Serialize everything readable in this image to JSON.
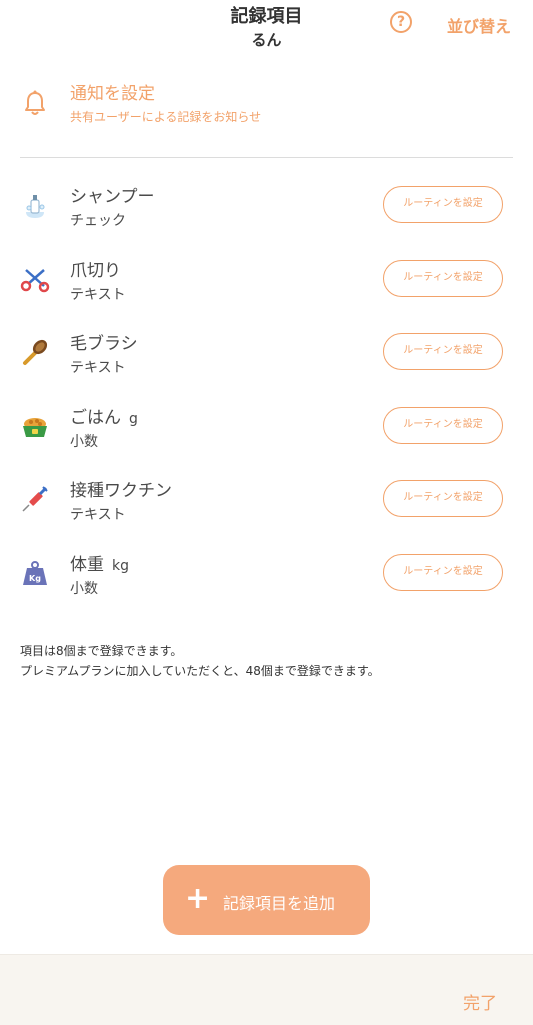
{
  "header": {
    "title": "記録項目",
    "subtitle": "るん",
    "help_icon": "?",
    "sort_label": "並び替え"
  },
  "notify": {
    "title": "通知を設定",
    "subtitle": "共有ユーザーによる記録をお知らせ",
    "icon": "bell-icon"
  },
  "items": [
    {
      "name": "シャンプー",
      "unit": "",
      "type": "チェック",
      "icon": "shampoo-icon",
      "routine_label": "ルーティンを設定"
    },
    {
      "name": "爪切り",
      "unit": "",
      "type": "テキスト",
      "icon": "scissors-icon",
      "routine_label": "ルーティンを設定"
    },
    {
      "name": "毛ブラシ",
      "unit": "",
      "type": "テキスト",
      "icon": "brush-icon",
      "routine_label": "ルーティンを設定"
    },
    {
      "name": "ごはん",
      "unit": "g",
      "type": "小数",
      "icon": "food-bowl-icon",
      "routine_label": "ルーティンを設定"
    },
    {
      "name": "接種ワクチン",
      "unit": "",
      "type": "テキスト",
      "icon": "syringe-icon",
      "routine_label": "ルーティンを設定"
    },
    {
      "name": "体重",
      "unit": "kg",
      "type": "小数",
      "icon": "weight-icon",
      "routine_label": "ルーティンを設定"
    }
  ],
  "note": {
    "line1": "項目は8個まで登録できます。",
    "line2": "プレミアムプランに加入していただくと、48個まで登録できます。"
  },
  "add_button": {
    "label": "記録項目を追加",
    "icon": "plus-icon"
  },
  "footer": {
    "done_label": "完了"
  },
  "colors": {
    "accent": "#f2a26a",
    "add_button_bg": "#f5a97d",
    "footer_bg": "#f8f5f0"
  }
}
